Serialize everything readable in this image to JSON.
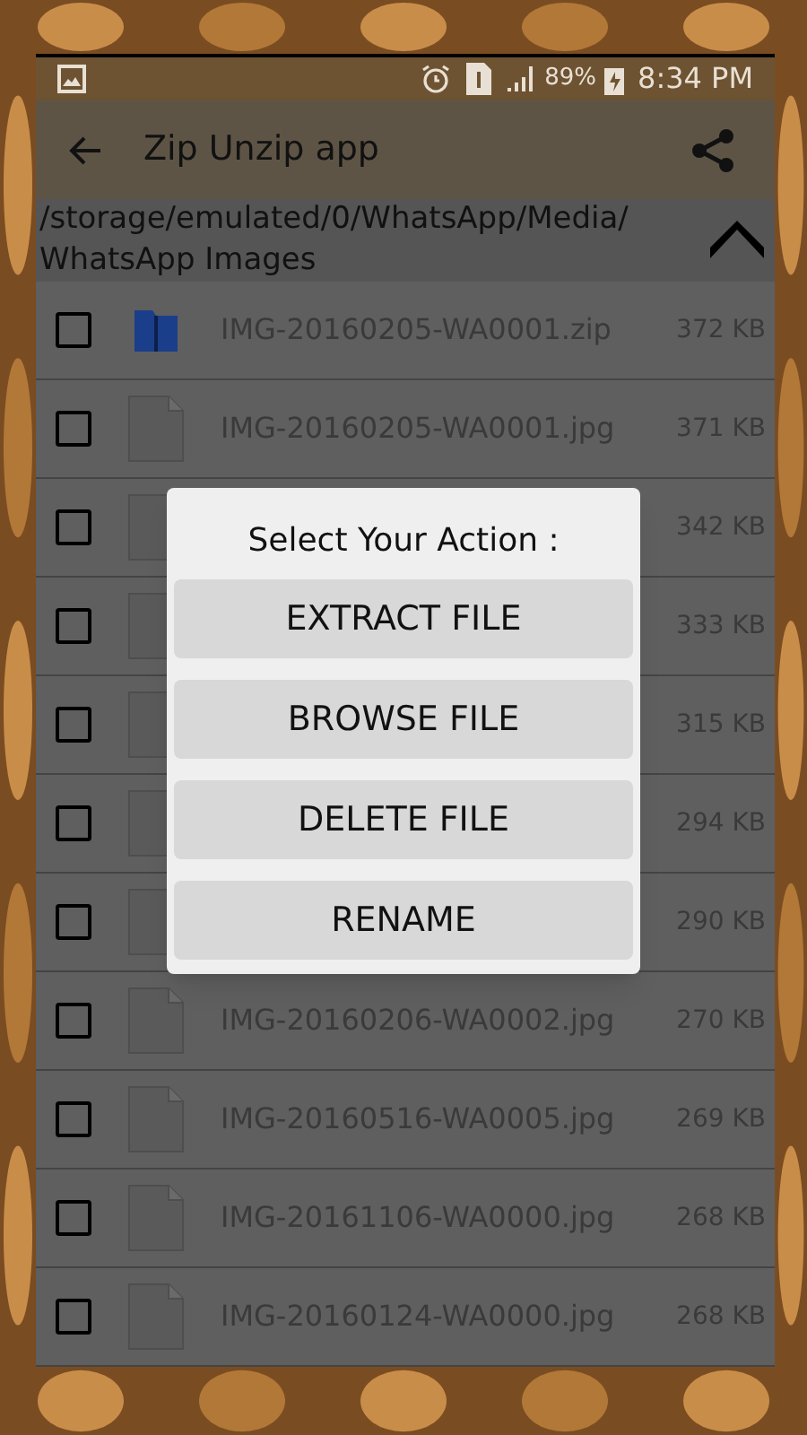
{
  "status_bar": {
    "battery": "89%",
    "time": "8:34 PM"
  },
  "toolbar": {
    "title": "Zip Unzip app"
  },
  "path": "/storage/emulated/0/WhatsApp/Media/ WhatsApp Images",
  "files": [
    {
      "kind": "zip",
      "name": "IMG-20160205-WA0001.zip",
      "size": "372 KB",
      "checked": false
    },
    {
      "kind": "jpg",
      "name": "IMG-20160205-WA0001.jpg",
      "size": "371 KB",
      "checked": false
    },
    {
      "kind": "jpg",
      "size": "342 KB",
      "checked": false
    },
    {
      "kind": "jpg",
      "size": "333 KB",
      "checked": false
    },
    {
      "kind": "jpg",
      "size": "315 KB",
      "checked": false
    },
    {
      "kind": "jpg",
      "size": "294 KB",
      "checked": false
    },
    {
      "kind": "jpg",
      "size": "290 KB",
      "checked": false
    },
    {
      "kind": "jpg",
      "name": "IMG-20160206-WA0002.jpg",
      "size": "270 KB",
      "checked": false
    },
    {
      "kind": "jpg",
      "name": "IMG-20160516-WA0005.jpg",
      "size": "269 KB",
      "checked": false
    },
    {
      "kind": "jpg",
      "name": "IMG-20161106-WA0000.jpg",
      "size": "268 KB",
      "checked": false
    },
    {
      "kind": "jpg",
      "name": "IMG-20160124-WA0000.jpg",
      "size": "268 KB",
      "checked": false
    }
  ],
  "dialog": {
    "title": "Select Your Action :",
    "buttons": [
      "EXTRACT FILE",
      "BROWSE FILE",
      "DELETE FILE",
      "RENAME"
    ]
  }
}
